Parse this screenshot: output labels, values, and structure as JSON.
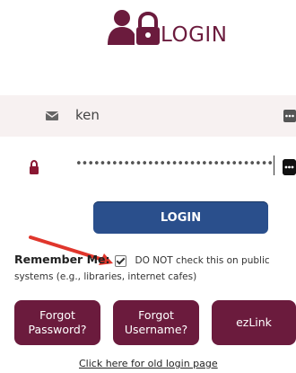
{
  "header": {
    "title": "LOGIN",
    "icon": "user-lock-icon",
    "accent_color": "#6b1b3d"
  },
  "username": {
    "value": "ken",
    "icon": "envelope-icon",
    "trailing_icon": "more-dots-icon"
  },
  "password": {
    "masked_value": "••••••••••••••••••••••••••••••••••••••••••",
    "icon": "lock-icon",
    "trailing_icon": "more-dots-icon"
  },
  "login_button": {
    "label": "LOGIN",
    "color": "#2a4f8c"
  },
  "remember": {
    "label": "Remember Me:",
    "checked": true,
    "note_line1": "DO NOT check this on public",
    "note_line2": "systems (e.g., libraries, internet cafes)"
  },
  "annotation": {
    "arrow_color": "#e0362c"
  },
  "buttons": {
    "forgot_password": "Forgot Password?",
    "forgot_username": "Forgot Username?",
    "ezlink": "ezLink"
  },
  "old_login_link": "Click here for old login page"
}
